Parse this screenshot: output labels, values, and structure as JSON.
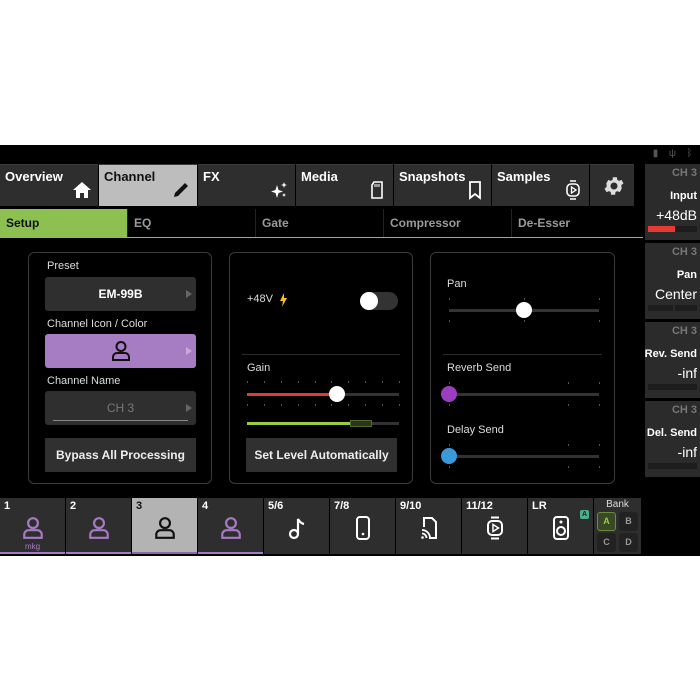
{
  "status_icons": [
    "sd-card-icon",
    "usb-icon",
    "bluetooth-icon"
  ],
  "top_tabs": [
    {
      "label": "Overview",
      "icon": "home-icon",
      "active": false
    },
    {
      "label": "Channel",
      "icon": "pencil-icon",
      "active": true
    },
    {
      "label": "FX",
      "icon": "sparkles-icon",
      "active": false
    },
    {
      "label": "Media",
      "icon": "sd-card-icon",
      "active": false
    },
    {
      "label": "Snapshots",
      "icon": "bookmark-icon",
      "active": false
    },
    {
      "label": "Samples",
      "icon": "sample-player-icon",
      "active": false
    }
  ],
  "settings_icon": "gear-icon",
  "sub_tabs": [
    {
      "label": "Setup",
      "active": true
    },
    {
      "label": "EQ",
      "active": false
    },
    {
      "label": "Gate",
      "active": false
    },
    {
      "label": "Compressor",
      "active": false
    },
    {
      "label": "De-Esser",
      "active": false
    }
  ],
  "setup": {
    "preset_label": "Preset",
    "preset_value": "EM-99B",
    "icon_color_label": "Channel Icon / Color",
    "icon_color_value": "person-icon",
    "icon_color_hex": "#a67cc2",
    "name_label": "Channel Name",
    "name_placeholder": "CH 3",
    "bypass_label": "Bypass All Processing"
  },
  "input": {
    "phantom_label": "+48V",
    "phantom_on": false,
    "gain_label": "Gain",
    "gain_fraction": 0.59,
    "level_meter_fraction": 0.68,
    "auto_level_label": "Set Level Automatically"
  },
  "sends": {
    "pan_label": "Pan",
    "pan_fraction": 0.5,
    "reverb_label": "Reverb Send",
    "reverb_fraction": 0.0,
    "reverb_color": "#9b3fc0",
    "delay_label": "Delay Send",
    "delay_fraction": 0.0,
    "delay_color": "#3a9ad9"
  },
  "sidebar": [
    {
      "channel": "CH 3",
      "name": "Input",
      "value": "+48dB",
      "bar_fraction": 0.55
    },
    {
      "channel": "CH 3",
      "name": "Pan",
      "value": "Center",
      "bar_fraction": 0
    },
    {
      "channel": "CH 3",
      "name": "Rev. Send",
      "value": "-inf",
      "bar_fraction": 0
    },
    {
      "channel": "CH 3",
      "name": "Del. Send",
      "value": "-inf",
      "bar_fraction": 0
    }
  ],
  "channels": [
    {
      "num": "1",
      "icon": "person-icon",
      "sub": "mkg",
      "active": false,
      "purple": true
    },
    {
      "num": "2",
      "icon": "person-icon",
      "sub": "",
      "active": false,
      "purple": true
    },
    {
      "num": "3",
      "icon": "person-icon",
      "sub": "",
      "active": true,
      "purple": true
    },
    {
      "num": "4",
      "icon": "person-icon",
      "sub": "",
      "active": false,
      "purple": true
    },
    {
      "num": "5/6",
      "icon": "music-note-icon",
      "sub": "",
      "active": false,
      "purple": false
    },
    {
      "num": "7/8",
      "icon": "phone-icon",
      "sub": "",
      "active": false,
      "purple": false
    },
    {
      "num": "9/10",
      "icon": "sd-stream-icon",
      "sub": "",
      "active": false,
      "purple": false
    },
    {
      "num": "11/12",
      "icon": "sample-player-icon",
      "sub": "",
      "active": false,
      "purple": false
    },
    {
      "num": "LR",
      "icon": "speaker-icon",
      "sub": "",
      "active": false,
      "purple": false,
      "badge": "A"
    }
  ],
  "bank": {
    "title": "Bank",
    "buttons": [
      "A",
      "B",
      "C",
      "D"
    ],
    "active": "A"
  }
}
